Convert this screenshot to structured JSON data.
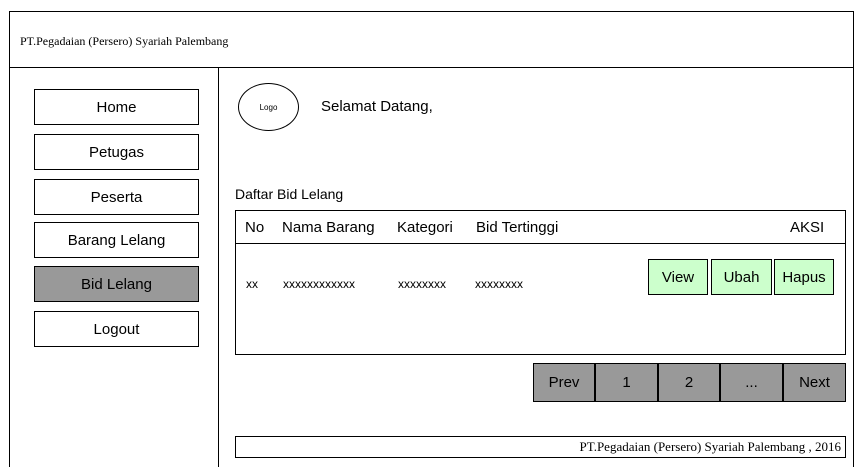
{
  "header": {
    "title": "PT.Pegadaian (Persero) Syariah Palembang"
  },
  "sidebar": {
    "items": [
      {
        "label": "Home"
      },
      {
        "label": "Petugas"
      },
      {
        "label": "Peserta"
      },
      {
        "label": "Barang Lelang"
      },
      {
        "label": "Bid Lelang",
        "active": true
      },
      {
        "label": "Logout"
      }
    ]
  },
  "main": {
    "logo_text": "Logo",
    "welcome": "Selamat Datang,",
    "list_title": "Daftar Bid Lelang",
    "table": {
      "columns": [
        "No",
        "Nama Barang",
        "Kategori",
        "Bid Tertinggi",
        "AKSI"
      ],
      "rows": [
        {
          "no": "xx",
          "nama_barang": "xxxxxxxxxxxx",
          "kategori": "xxxxxxxx",
          "bid_tertinggi": "xxxxxxxx"
        }
      ],
      "actions": [
        "View",
        "Ubah",
        "Hapus"
      ]
    },
    "pagination": [
      "Prev",
      "1",
      "2",
      "...",
      "Next"
    ]
  },
  "footer": {
    "text": "PT.Pegadaian (Persero) Syariah Palembang , 2016"
  },
  "colors": {
    "active_nav": "#999999",
    "action_button": "#ccffcc",
    "pagination_button": "#999999"
  }
}
